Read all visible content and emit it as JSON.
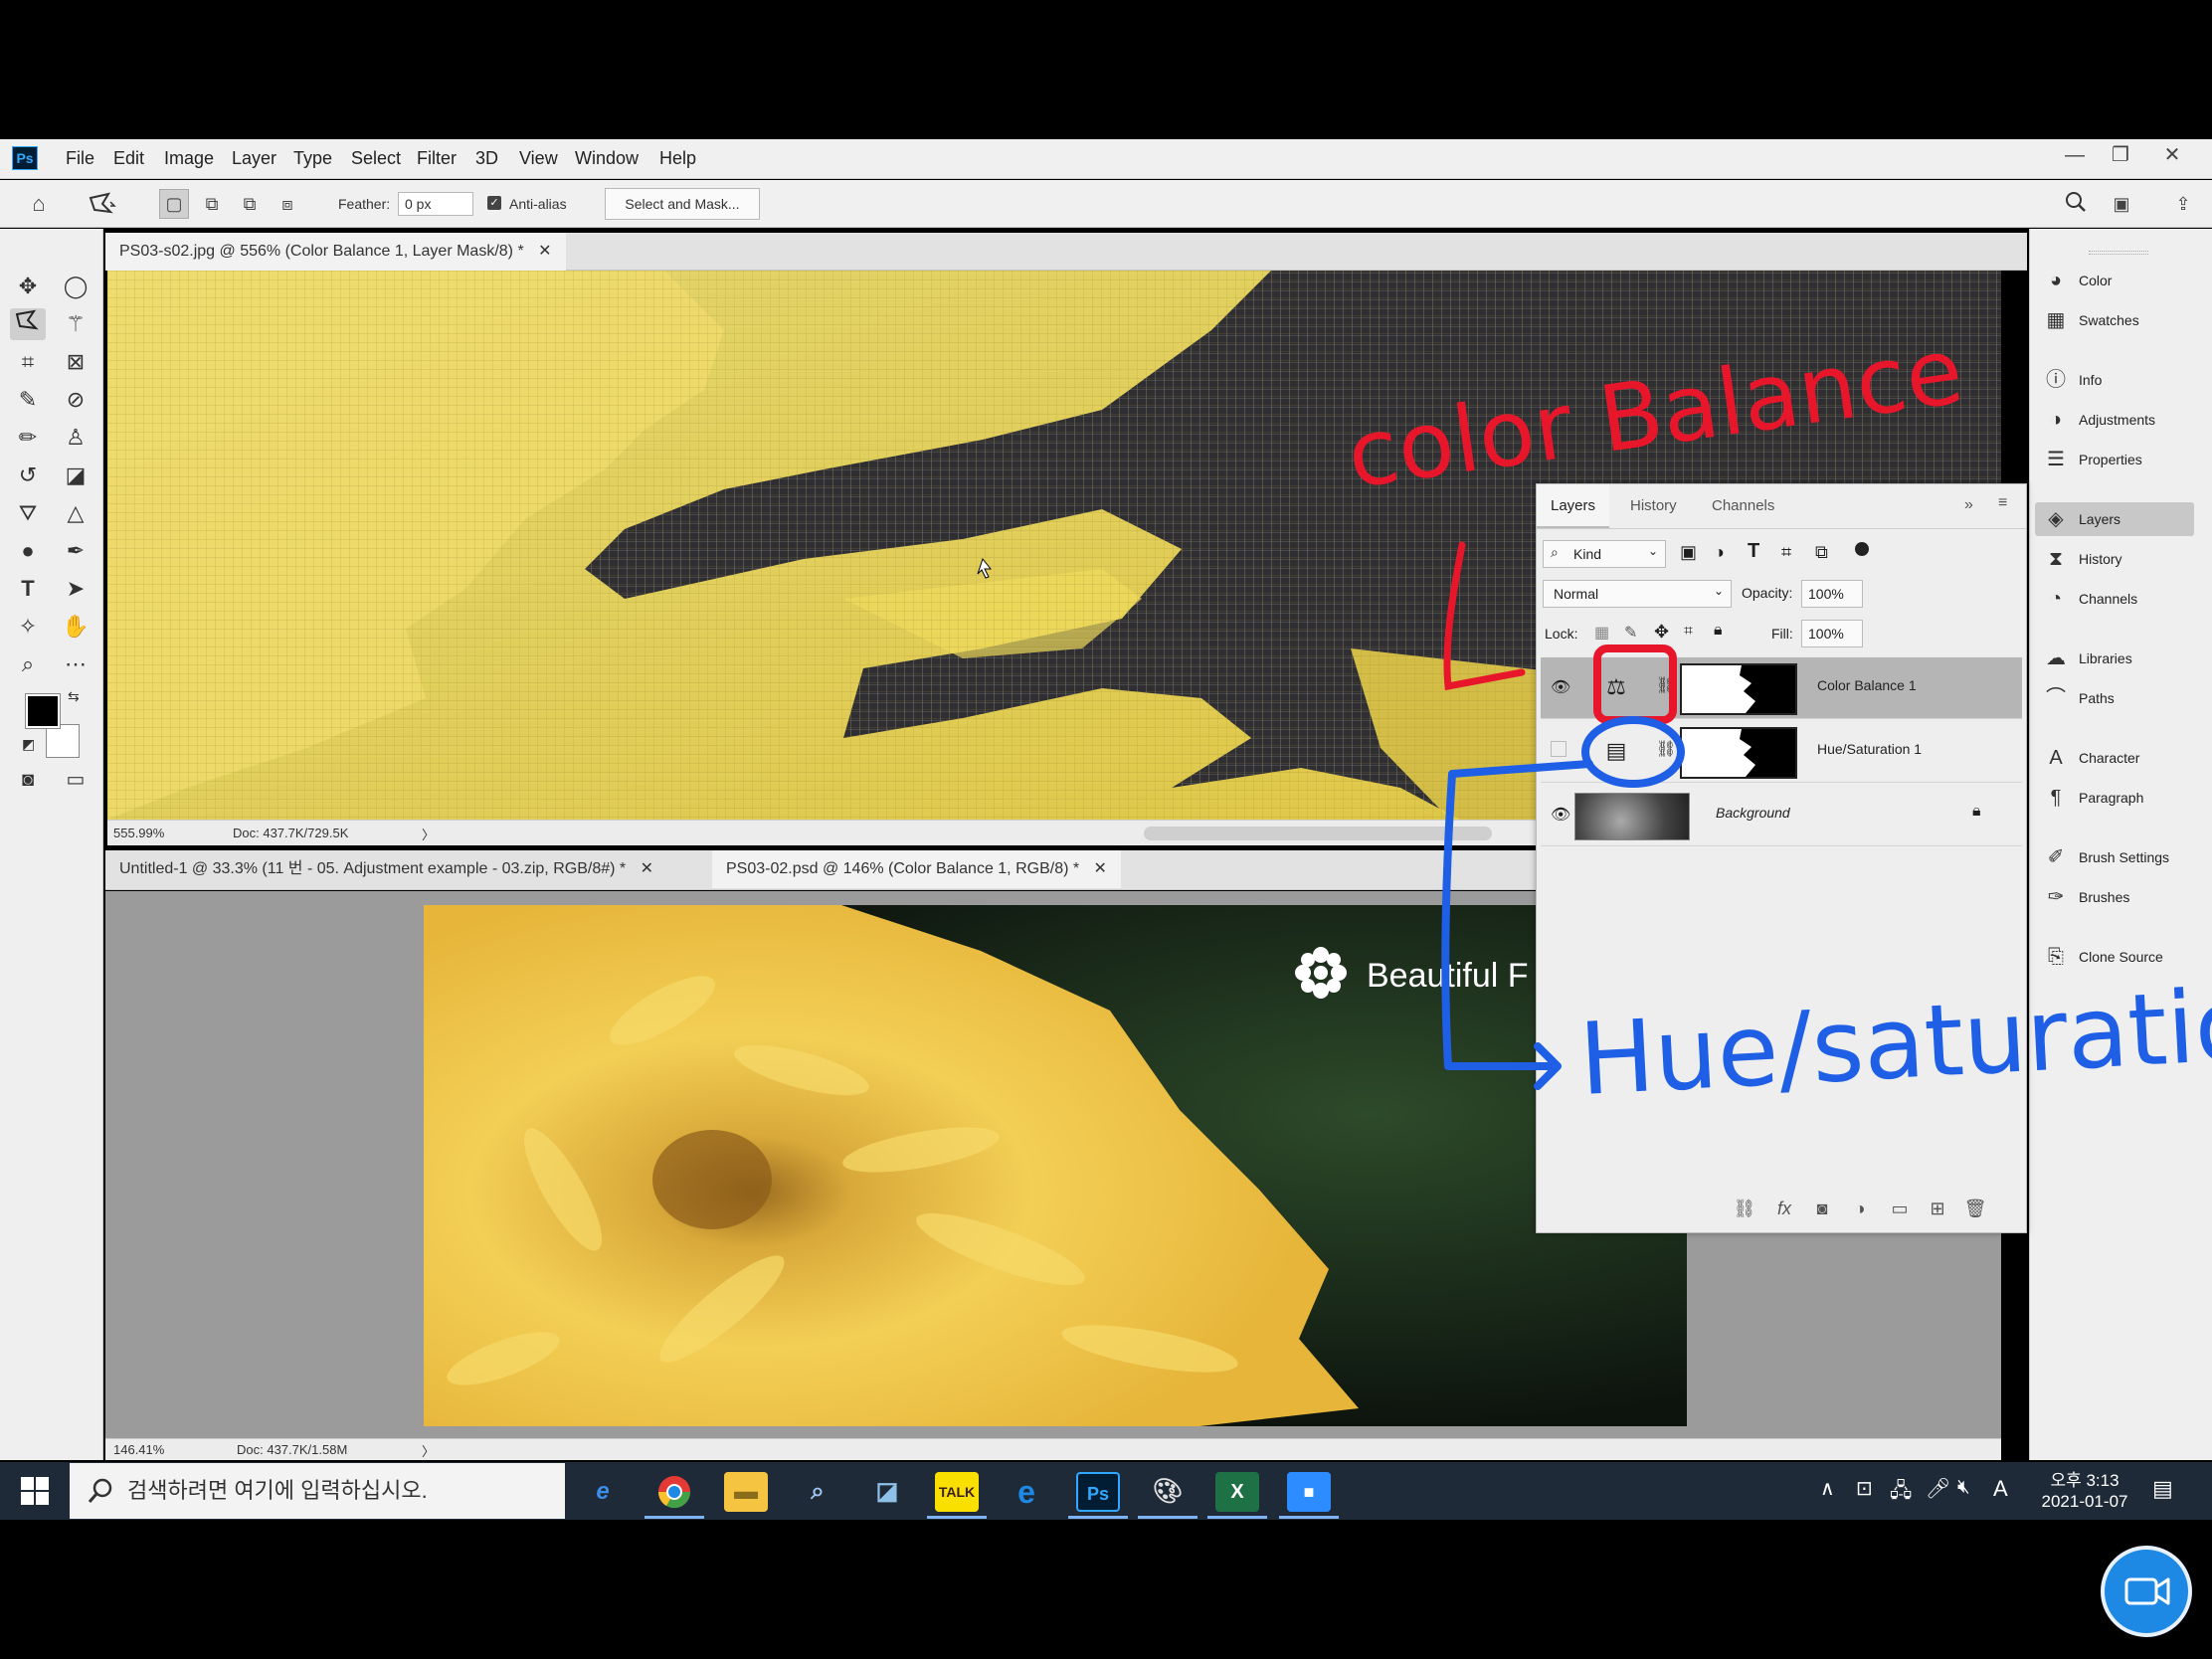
{
  "app": {
    "logo": "Ps"
  },
  "menu": [
    "File",
    "Edit",
    "Image",
    "Layer",
    "Type",
    "Select",
    "Filter",
    "3D",
    "View",
    "Window",
    "Help"
  ],
  "window_controls": {
    "minimize": "—",
    "restore": "❐",
    "close": "✕"
  },
  "options": {
    "feather_label": "Feather:",
    "feather_value": "0 px",
    "antialias_label": "Anti-alias",
    "select_mask": "Select and Mask..."
  },
  "doc1": {
    "tab": "PS03-s02.jpg @ 556% (Color Balance 1, Layer Mask/8) *",
    "close": "✕",
    "zoom": "555.99%",
    "doc": "Doc: 437.7K/729.5K",
    "arrow": "〉"
  },
  "doc2": {
    "tab1": "Untitled-1 @ 33.3% (11 번   - 05. Adjustment example  - 03.zip, RGB/8#) *",
    "tab2": "PS03-02.psd @ 146% (Color Balance 1, RGB/8) *",
    "close": "✕",
    "zoom": "146.41%",
    "doc": "Doc: 437.7K/1.58M",
    "arrow": "〉",
    "banner_text": "Beautiful F"
  },
  "layers_panel": {
    "tabs": [
      "Layers",
      "History",
      "Channels"
    ],
    "kind": "Kind",
    "blend_mode": "Normal",
    "opacity_label": "Opacity:",
    "opacity_value": "100%",
    "lock_label": "Lock:",
    "fill_label": "Fill:",
    "fill_value": "100%",
    "layers": [
      {
        "name": "Color Balance 1",
        "visible": true
      },
      {
        "name": "Hue/Saturation 1",
        "visible": false
      },
      {
        "name": "Background",
        "visible": true
      }
    ]
  },
  "dock": [
    "Color",
    "Swatches",
    "Info",
    "Adjustments",
    "Properties",
    "Layers",
    "History",
    "Channels",
    "Libraries",
    "Paths",
    "Character",
    "Paragraph",
    "Brush Settings",
    "Brushes",
    "Clone Source"
  ],
  "annotations": {
    "top": "color Balance",
    "bottom": "Hue/saturation"
  },
  "taskbar": {
    "search": "검색하려면 여기에 입력하십시오.",
    "time": "오후 3:13",
    "date": "2021-01-07",
    "ime": "A"
  },
  "colors": {
    "photoshop_blue": "#31a8ff",
    "annotation_red": "#e8162a",
    "annotation_blue": "#1e5fe6",
    "taskbar": "#1f2a38",
    "selected_layer": "#b5b5b5"
  }
}
